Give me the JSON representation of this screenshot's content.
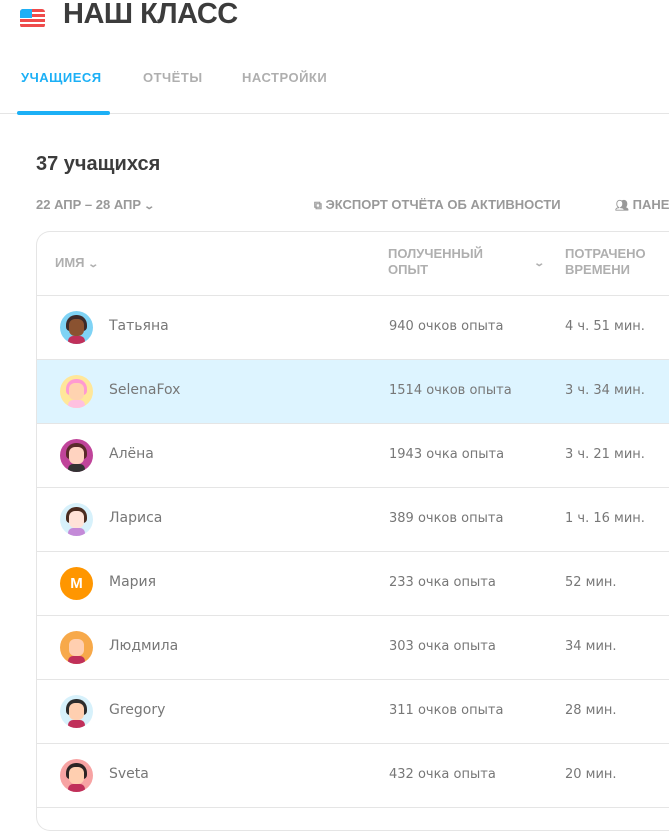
{
  "header": {
    "title": "НАШ КЛАСС",
    "flag_icon": "us-flag-icon"
  },
  "tabs": [
    {
      "label": "УЧАЩИЕСЯ",
      "active": true
    },
    {
      "label": "ОТЧЁТЫ"
    },
    {
      "label": "НАСТРОЙКИ"
    }
  ],
  "summary": {
    "count_label": "37 учащихся"
  },
  "toolbar": {
    "date_range": "22 АПР – 28 АПР",
    "export_label": "ЭКСПОРТ ОТЧЁТА ОБ АКТИВНОСТИ",
    "panel_label": "ПАНЕ"
  },
  "table": {
    "columns": {
      "name": "ИМЯ",
      "xp_line1": "ПОЛУЧЕННЫЙ",
      "xp_line2": "ОПЫТ",
      "time_line1": "ПОТРАЧЕНО",
      "time_line2": "ВРЕМЕНИ"
    },
    "rows": [
      {
        "name": "Татьяна",
        "xp": "940 очков опыта",
        "time": "4 ч. 51 мин.",
        "avatar_bg": "#7fd3f5",
        "hair": "#3c2a2a",
        "face": "#8a5230",
        "shirt": "#c0305a"
      },
      {
        "name": "SelenaFox",
        "xp": "1514 очков опыта",
        "time": "3 ч. 34 мин.",
        "avatar_bg": "#ffe79a",
        "hair": "#ff9ad1",
        "face": "#ffd3b0",
        "shirt": "#ffc0e0"
      },
      {
        "name": "Алёна",
        "xp": "1943 очка опыта",
        "time": "3 ч. 21 мин.",
        "avatar_bg": "#c0449a",
        "hair": "#5a2a2a",
        "face": "#ffd3c0",
        "shirt": "#333333"
      },
      {
        "name": "Лариса",
        "xp": "389 очков опыта",
        "time": "1 ч. 16 мин.",
        "avatar_bg": "#d7f1fb",
        "hair": "#4a2c20",
        "face": "#ffe3d8",
        "shirt": "#c48ad8"
      },
      {
        "name": "Мария",
        "xp": "233 очка опыта",
        "time": "52 мин.",
        "avatar_bg": "#ff9600",
        "letter": "М"
      },
      {
        "name": "Людмила",
        "xp": "303 очка опыта",
        "time": "34 мин.",
        "avatar_bg": "#f7a94a",
        "hair": "#f7a94a",
        "face": "#ffcfb0",
        "shirt": "#c0305a"
      },
      {
        "name": "Gregory",
        "xp": "311 очков опыта",
        "time": "28 мин.",
        "avatar_bg": "#d7f1fb",
        "hair": "#2c2c2c",
        "face": "#ffcfb0",
        "shirt": "#c0305a"
      },
      {
        "name": "Sveta",
        "xp": "432 очка опыта",
        "time": "20 мин.",
        "avatar_bg": "#f7a3a3",
        "hair": "#2c2424",
        "face": "#ffcfb0",
        "shirt": "#c0305a"
      }
    ]
  }
}
